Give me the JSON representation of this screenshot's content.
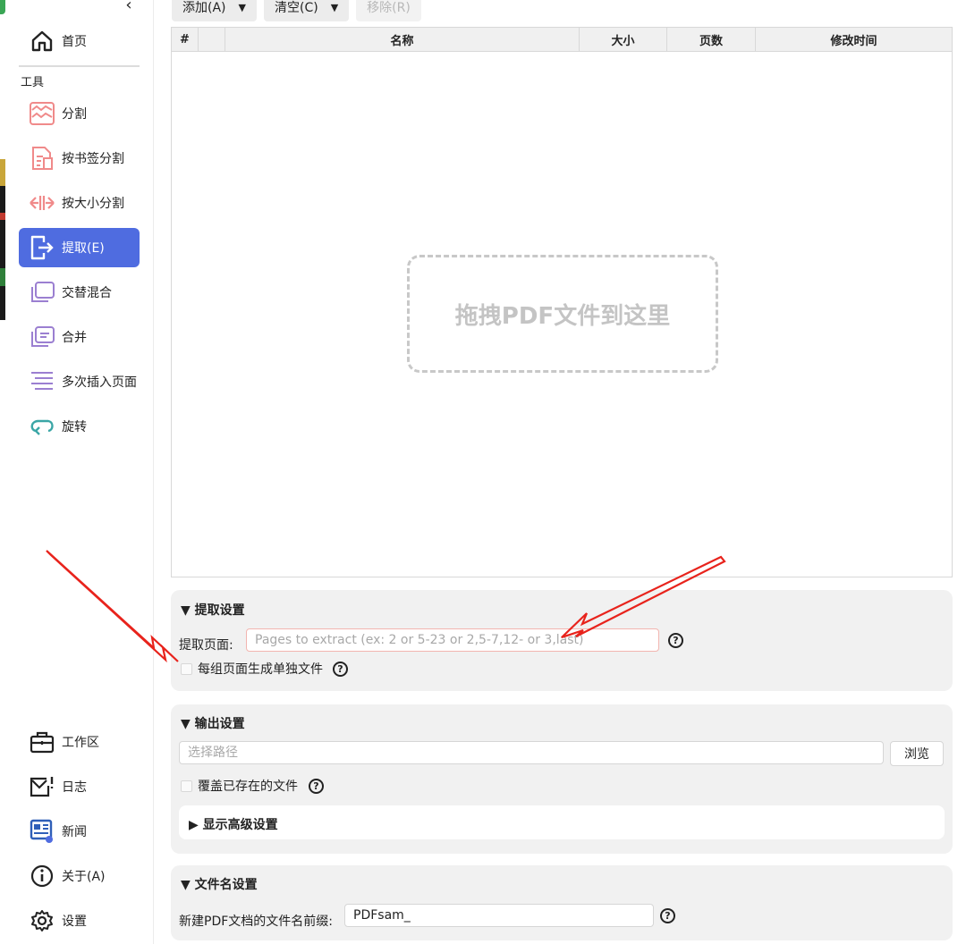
{
  "sidebar": {
    "home": "首页",
    "tools_label": "工具",
    "items": [
      {
        "label": "分割",
        "icon": "split-icon"
      },
      {
        "label": "按书签分割",
        "icon": "bookmark-split-icon"
      },
      {
        "label": "按大小分割",
        "icon": "size-split-icon"
      },
      {
        "label": "提取(E)",
        "icon": "extract-icon",
        "active": true
      },
      {
        "label": "交替混合",
        "icon": "alternate-mix-icon"
      },
      {
        "label": "合并",
        "icon": "merge-icon"
      },
      {
        "label": "多次插入页面",
        "icon": "insert-pages-icon"
      },
      {
        "label": "旋转",
        "icon": "rotate-icon"
      }
    ],
    "bottom": [
      {
        "label": "工作区",
        "icon": "briefcase-icon"
      },
      {
        "label": "日志",
        "icon": "log-icon"
      },
      {
        "label": "新闻",
        "icon": "news-icon"
      },
      {
        "label": "关于(A)",
        "icon": "info-icon"
      },
      {
        "label": "设置",
        "icon": "gear-icon"
      }
    ],
    "accent": "#4f6ce0",
    "tool_icon_color": "#f08a8a",
    "purple_icon_color": "#9b7fd1",
    "rotate_icon_color": "#3aa6a6"
  },
  "toolbar": {
    "add": "添加(A)",
    "clear": "清空(C)",
    "remove": "移除(R)"
  },
  "table": {
    "headers": [
      "#",
      "",
      "名称",
      "大小",
      "页数",
      "修改时间"
    ],
    "dropzone": "拖拽PDF文件到这里"
  },
  "extract_settings": {
    "title": "提取设置",
    "pages_label": "提取页面:",
    "pages_placeholder": "Pages to extract (ex: 2 or 5-23 or 2,5-7,12- or 3,last)",
    "separate_files_label": "每组页面生成单独文件"
  },
  "output_settings": {
    "title": "输出设置",
    "path_placeholder": "选择路径",
    "browse": "浏览",
    "overwrite_label": "覆盖已存在的文件",
    "advanced": "显示高级设置"
  },
  "filename_settings": {
    "title": "文件名设置",
    "prefix_label": "新建PDF文档的文件名前缀:",
    "prefix_value": "PDFsam_"
  },
  "annotation_color": "#e8231c"
}
